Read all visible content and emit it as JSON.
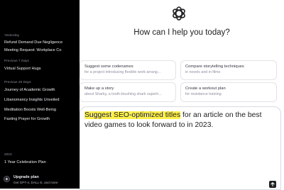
{
  "sidebar": {
    "groups": [
      {
        "label": "Yesterday",
        "items": [
          "Refund Demand Due Negligence",
          "Meeting Request: Workplace Co"
        ]
      },
      {
        "label": "Previous 7 Days",
        "items": [
          "Virtual Support Hugs"
        ]
      },
      {
        "label": "Previous 30 Days",
        "items": [
          "Journey of Academic Growth",
          "Libanomancy Insights Unveiled",
          "Meditation Boosts Well-Being",
          "Fasting Prayer for Growth"
        ]
      },
      {
        "label": "2023",
        "items": [
          "1 Year Celebration Plan"
        ]
      }
    ],
    "upgrade": {
      "title": "Upgrade plan",
      "subtitle": "Get GPT-4, DALL·E, and more"
    }
  },
  "main": {
    "heading": "How can I help you today?",
    "suggestions": [
      {
        "title": "Suggest some codenames",
        "subtitle": "for a project introducing flexible work arrang..."
      },
      {
        "title": "Compare storytelling techniques",
        "subtitle": "in novels and in films"
      },
      {
        "title": "Make up a story",
        "subtitle": "about Sharky, a tooth-brushing shark superh..."
      },
      {
        "title": "Create a workout plan",
        "subtitle": "for resistance training"
      }
    ],
    "composer": {
      "highlight": "Suggest SEO-optimized titles",
      "rest": " for an article on the best video games to look forward to in 2023."
    },
    "icons": {
      "logo": "openai-logo-icon",
      "send": "arrow-up-icon",
      "upgrade": "sparkle-icon"
    }
  },
  "colors": {
    "sidebar_bg": "#000000",
    "highlight": "#fff14a",
    "accent": "#202123"
  }
}
